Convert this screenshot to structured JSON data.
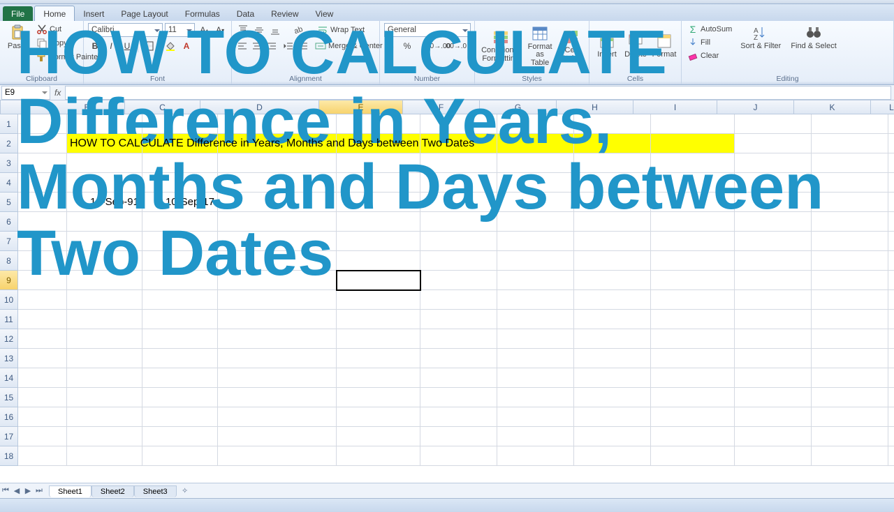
{
  "tabs": {
    "file": "File",
    "list": [
      "Home",
      "Insert",
      "Page Layout",
      "Formulas",
      "Data",
      "Review",
      "View"
    ],
    "activeIndex": 0
  },
  "ribbon": {
    "clipboard": {
      "label": "Clipboard",
      "paste": "Paste",
      "cut": "Cut",
      "copy": "Copy",
      "formatPainter": "Format Painter"
    },
    "font": {
      "label": "Font",
      "name": "Calibri",
      "size": "11"
    },
    "alignment": {
      "label": "Alignment",
      "wrap": "Wrap Text",
      "merge": "Merge & Center"
    },
    "number": {
      "label": "Number",
      "format": "General"
    },
    "styles": {
      "label": "Styles",
      "conditional": "Conditional Formatting",
      "formatTable": "Format as Table",
      "cellStyles": "Cell Styles"
    },
    "cells": {
      "label": "Cells",
      "insert": "Insert",
      "delete": "Delete",
      "format": "Format"
    },
    "editing": {
      "label": "Editing",
      "autosum": "AutoSum",
      "fill": "Fill",
      "clear": "Clear",
      "sort": "Sort & Filter",
      "find": "Find & Select"
    }
  },
  "formulaBar": {
    "nameBox": "E9",
    "formula": ""
  },
  "columns": [
    "A",
    "B",
    "C",
    "D",
    "E",
    "F",
    "G",
    "H",
    "I",
    "J",
    "K",
    "L"
  ],
  "activeCell": {
    "col": "E",
    "row": 9
  },
  "cells": {
    "B2": "HOW TO CALCULATE  Difference in Years, Months and Days between Two Dates",
    "B5": "12-Sep-91",
    "C5": "10-Sep-17"
  },
  "sheets": {
    "list": [
      "Sheet1",
      "Sheet2",
      "Sheet3"
    ],
    "activeIndex": 0
  },
  "overlay": {
    "line1": "HOW TO CALCULATE",
    "rest": "Difference in Years, Months and Days between Two Dates"
  }
}
